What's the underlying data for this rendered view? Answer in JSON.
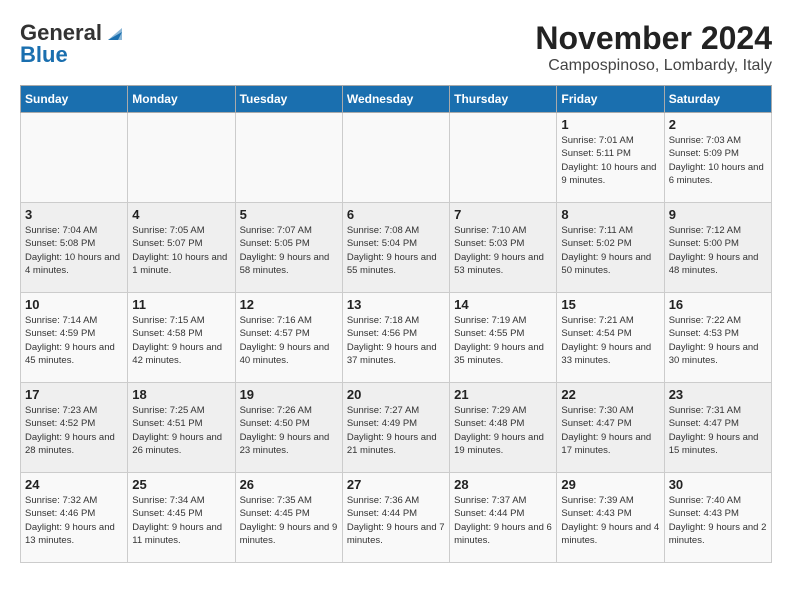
{
  "header": {
    "logo_general": "General",
    "logo_blue": "Blue",
    "title": "November 2024",
    "subtitle": "Campospinoso, Lombardy, Italy"
  },
  "weekdays": [
    "Sunday",
    "Monday",
    "Tuesday",
    "Wednesday",
    "Thursday",
    "Friday",
    "Saturday"
  ],
  "weeks": [
    [
      {
        "day": "",
        "info": ""
      },
      {
        "day": "",
        "info": ""
      },
      {
        "day": "",
        "info": ""
      },
      {
        "day": "",
        "info": ""
      },
      {
        "day": "",
        "info": ""
      },
      {
        "day": "1",
        "info": "Sunrise: 7:01 AM\nSunset: 5:11 PM\nDaylight: 10 hours and 9 minutes."
      },
      {
        "day": "2",
        "info": "Sunrise: 7:03 AM\nSunset: 5:09 PM\nDaylight: 10 hours and 6 minutes."
      }
    ],
    [
      {
        "day": "3",
        "info": "Sunrise: 7:04 AM\nSunset: 5:08 PM\nDaylight: 10 hours and 4 minutes."
      },
      {
        "day": "4",
        "info": "Sunrise: 7:05 AM\nSunset: 5:07 PM\nDaylight: 10 hours and 1 minute."
      },
      {
        "day": "5",
        "info": "Sunrise: 7:07 AM\nSunset: 5:05 PM\nDaylight: 9 hours and 58 minutes."
      },
      {
        "day": "6",
        "info": "Sunrise: 7:08 AM\nSunset: 5:04 PM\nDaylight: 9 hours and 55 minutes."
      },
      {
        "day": "7",
        "info": "Sunrise: 7:10 AM\nSunset: 5:03 PM\nDaylight: 9 hours and 53 minutes."
      },
      {
        "day": "8",
        "info": "Sunrise: 7:11 AM\nSunset: 5:02 PM\nDaylight: 9 hours and 50 minutes."
      },
      {
        "day": "9",
        "info": "Sunrise: 7:12 AM\nSunset: 5:00 PM\nDaylight: 9 hours and 48 minutes."
      }
    ],
    [
      {
        "day": "10",
        "info": "Sunrise: 7:14 AM\nSunset: 4:59 PM\nDaylight: 9 hours and 45 minutes."
      },
      {
        "day": "11",
        "info": "Sunrise: 7:15 AM\nSunset: 4:58 PM\nDaylight: 9 hours and 42 minutes."
      },
      {
        "day": "12",
        "info": "Sunrise: 7:16 AM\nSunset: 4:57 PM\nDaylight: 9 hours and 40 minutes."
      },
      {
        "day": "13",
        "info": "Sunrise: 7:18 AM\nSunset: 4:56 PM\nDaylight: 9 hours and 37 minutes."
      },
      {
        "day": "14",
        "info": "Sunrise: 7:19 AM\nSunset: 4:55 PM\nDaylight: 9 hours and 35 minutes."
      },
      {
        "day": "15",
        "info": "Sunrise: 7:21 AM\nSunset: 4:54 PM\nDaylight: 9 hours and 33 minutes."
      },
      {
        "day": "16",
        "info": "Sunrise: 7:22 AM\nSunset: 4:53 PM\nDaylight: 9 hours and 30 minutes."
      }
    ],
    [
      {
        "day": "17",
        "info": "Sunrise: 7:23 AM\nSunset: 4:52 PM\nDaylight: 9 hours and 28 minutes."
      },
      {
        "day": "18",
        "info": "Sunrise: 7:25 AM\nSunset: 4:51 PM\nDaylight: 9 hours and 26 minutes."
      },
      {
        "day": "19",
        "info": "Sunrise: 7:26 AM\nSunset: 4:50 PM\nDaylight: 9 hours and 23 minutes."
      },
      {
        "day": "20",
        "info": "Sunrise: 7:27 AM\nSunset: 4:49 PM\nDaylight: 9 hours and 21 minutes."
      },
      {
        "day": "21",
        "info": "Sunrise: 7:29 AM\nSunset: 4:48 PM\nDaylight: 9 hours and 19 minutes."
      },
      {
        "day": "22",
        "info": "Sunrise: 7:30 AM\nSunset: 4:47 PM\nDaylight: 9 hours and 17 minutes."
      },
      {
        "day": "23",
        "info": "Sunrise: 7:31 AM\nSunset: 4:47 PM\nDaylight: 9 hours and 15 minutes."
      }
    ],
    [
      {
        "day": "24",
        "info": "Sunrise: 7:32 AM\nSunset: 4:46 PM\nDaylight: 9 hours and 13 minutes."
      },
      {
        "day": "25",
        "info": "Sunrise: 7:34 AM\nSunset: 4:45 PM\nDaylight: 9 hours and 11 minutes."
      },
      {
        "day": "26",
        "info": "Sunrise: 7:35 AM\nSunset: 4:45 PM\nDaylight: 9 hours and 9 minutes."
      },
      {
        "day": "27",
        "info": "Sunrise: 7:36 AM\nSunset: 4:44 PM\nDaylight: 9 hours and 7 minutes."
      },
      {
        "day": "28",
        "info": "Sunrise: 7:37 AM\nSunset: 4:44 PM\nDaylight: 9 hours and 6 minutes."
      },
      {
        "day": "29",
        "info": "Sunrise: 7:39 AM\nSunset: 4:43 PM\nDaylight: 9 hours and 4 minutes."
      },
      {
        "day": "30",
        "info": "Sunrise: 7:40 AM\nSunset: 4:43 PM\nDaylight: 9 hours and 2 minutes."
      }
    ]
  ]
}
